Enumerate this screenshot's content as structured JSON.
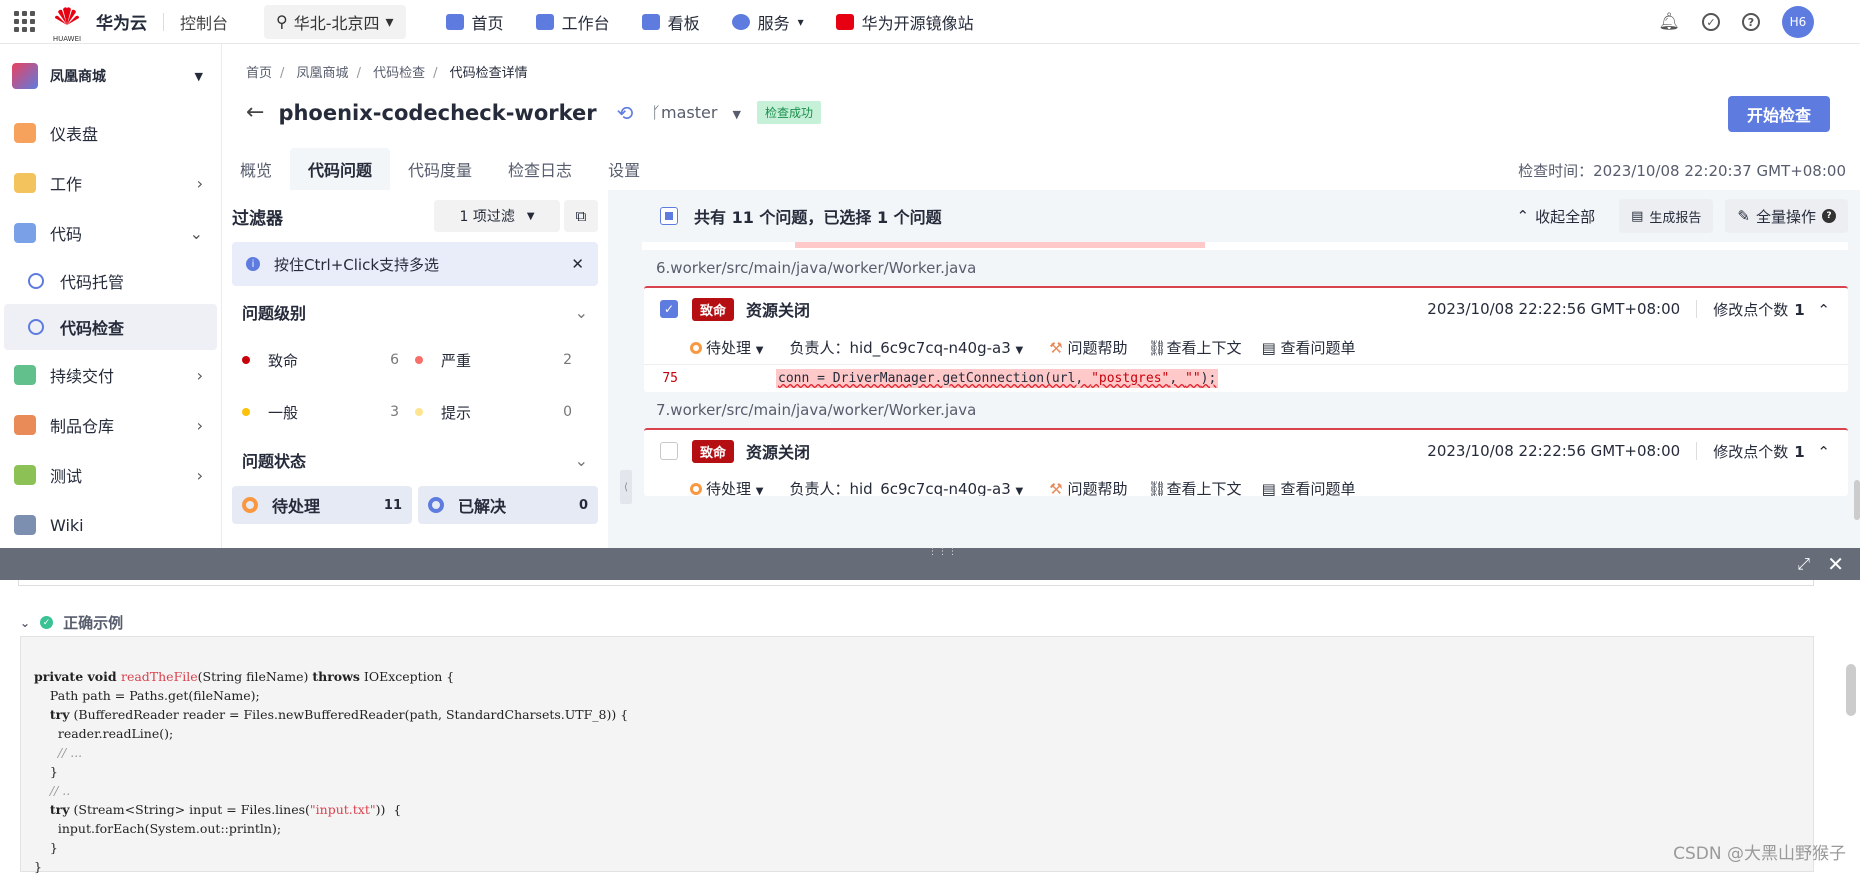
{
  "topbar": {
    "brand": "华为云",
    "logo_text": "HUAWEI",
    "console": "控制台",
    "region": "华北-北京四",
    "nav": [
      {
        "label": "首页",
        "icon": "home-icon"
      },
      {
        "label": "工作台",
        "icon": "workbench-icon"
      },
      {
        "label": "看板",
        "icon": "dashboard-icon"
      },
      {
        "label": "服务",
        "icon": "service-icon"
      },
      {
        "label": "华为开源镜像站",
        "icon": "mirror-icon"
      }
    ],
    "avatar": "H6"
  },
  "sidebar": {
    "project": "凤凰商城",
    "items": [
      {
        "label": "仪表盘",
        "color": "#f6a15c"
      },
      {
        "label": "工作",
        "color": "#f3c35d"
      },
      {
        "label": "代码",
        "color": "#7aa0e8"
      }
    ],
    "subitems": [
      "代码托管",
      "代码检查"
    ],
    "items2": [
      {
        "label": "持续交付",
        "color": "#62c08c"
      },
      {
        "label": "制品仓库",
        "color": "#e88b59"
      },
      {
        "label": "测试",
        "color": "#8cc255"
      },
      {
        "label": "Wiki",
        "color": "#7c8fb0"
      }
    ]
  },
  "breadcrumb": [
    "首页",
    "凤凰商城",
    "代码检查",
    "代码检查详情"
  ],
  "header": {
    "title": "phoenix-codecheck-worker",
    "branch": "master",
    "status": "检查成功",
    "start_button": "开始检查",
    "check_time": "检查时间：2023/10/08 22:20:37 GMT+08:00"
  },
  "tabs": [
    "概览",
    "代码问题",
    "代码度量",
    "检查日志",
    "设置"
  ],
  "filter": {
    "title": "过滤器",
    "select": "1 项过滤",
    "tip": "按住Ctrl+Click支持多选",
    "level_title": "问题级别",
    "levels": [
      {
        "label": "致命",
        "count": "6",
        "color": "#c7000b"
      },
      {
        "label": "严重",
        "count": "2",
        "color": "#f66f6a"
      },
      {
        "label": "一般",
        "count": "3",
        "color": "#fac20a"
      },
      {
        "label": "提示",
        "count": "0",
        "color": "#ffe58f"
      }
    ],
    "state_title": "问题状态",
    "states": [
      {
        "label": "待处理",
        "count": "11",
        "color": "#fa9841"
      },
      {
        "label": "已解决",
        "count": "0",
        "color": "#5e7ce0"
      }
    ]
  },
  "issues": {
    "summary": "共有 11 个问题，已选择 1 个问题",
    "collapse_all": "收起全部",
    "report": "生成报告",
    "bulk": "全量操作",
    "cards": [
      {
        "path": "6.worker/src/main/java/worker/Worker.java",
        "checked": true,
        "severity": "致命",
        "rule": "资源关闭",
        "time": "2023/10/08 22:22:56 GMT+08:00",
        "mod_label": "修改点个数",
        "mod_count": "1",
        "status": "待处理",
        "owner": "负责人：hid_6c9c7cq-n40g-a3",
        "help": "问题帮助",
        "context": "查看上下文",
        "ticket": "查看问题单",
        "line_no": "75",
        "code_a": "conn = DriverManager.getConnection(url, ",
        "code_b": "\"postgres\"",
        "code_c": ", ",
        "code_d": "\"\"",
        "code_e": ");"
      },
      {
        "path": "7.worker/src/main/java/worker/Worker.java",
        "checked": false,
        "severity": "致命",
        "rule": "资源关闭",
        "time": "2023/10/08 22:22:56 GMT+08:00",
        "mod_label": "修改点个数",
        "mod_count": "1",
        "status": "待处理",
        "owner": "负责人：hid_6c9c7cq-n40g-a3",
        "help": "问题帮助",
        "context": "查看上下文",
        "ticket": "查看问题单"
      }
    ]
  },
  "panel": {
    "example_title": "正确示例",
    "code": {
      "l1a": "private void ",
      "l1b": "readTheFile",
      "l1c": "(String fileName) ",
      "l1d": "throws",
      "l1e": " IOException {",
      "l2": "    Path path = Paths.get(fileName);",
      "l3a": "    ",
      "l3b": "try",
      "l3c": " (BufferedReader reader = Files.newBufferedReader(path, StandardCharsets.UTF_8)) {",
      "l4": "      reader.readLine();",
      "l5": "      // ...",
      "l6": "    }",
      "l7": "    // ..",
      "l8a": "    ",
      "l8b": "try",
      "l8c": " (Stream<String> input = Files.lines(",
      "l8d": "\"input.txt\"",
      "l8e": "))  {",
      "l9": "      input.forEach(System.out::println);",
      "l10": "    }",
      "l11": "}"
    },
    "watermark": "CSDN @大黑山野猴子"
  }
}
